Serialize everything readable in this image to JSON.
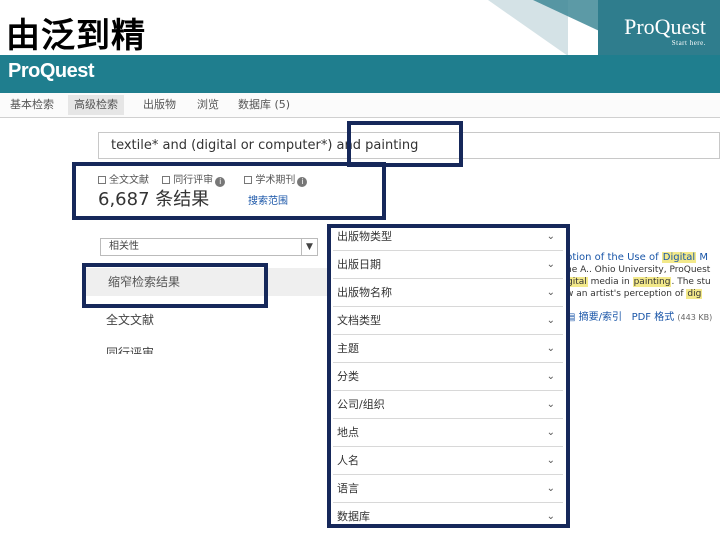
{
  "slide": {
    "title": "由泛到精",
    "logo_small": "ProQuest",
    "logo_tagline": "Start here."
  },
  "brand": {
    "logo": "ProQuest"
  },
  "nav": {
    "tabs": [
      "基本检索",
      "高级检索",
      "出版物",
      "浏览",
      "数据库 (5)"
    ],
    "active_index": 1
  },
  "search": {
    "query": "textile* and (digital or computer*) and painting"
  },
  "filters": {
    "full_text": "全文文献",
    "peer_reviewed": "同行评审",
    "scholarly": "学术期刊"
  },
  "results": {
    "count_text": "6,687 条结果",
    "scope_link": "搜索范围"
  },
  "sort": {
    "selected": "相关性"
  },
  "left_panel": {
    "narrow_label": "缩窄检索结果",
    "full_text_label": "全文文献",
    "peer_review_label": "同行评审"
  },
  "facets": [
    "出版物类型",
    "出版日期",
    "出版物名称",
    "文档类型",
    "主题",
    "分类",
    "公司/组织",
    "地点",
    "人名",
    "语言",
    "数据库"
  ],
  "preview": {
    "title_pre": "ption of the Use of ",
    "title_mark": "Digital",
    "title_post": " M",
    "author": "ne A.. Ohio University, ProQuest",
    "line1_mark": "gital",
    "line1_post": " media in ",
    "line1_mark2": "painting",
    "line1_end": ". The stu",
    "line2_pre": "w an artist's perception of ",
    "line2_mark": "dig",
    "link_abstract": "摘要/索引",
    "link_pdf": "PDF 格式",
    "pdf_size": "(443 KB)"
  },
  "colors": {
    "brand_teal": "#1f7e8e",
    "highlight_border": "#16285a",
    "link_blue": "#1a56a8",
    "term_highlight": "#f3e98a"
  }
}
